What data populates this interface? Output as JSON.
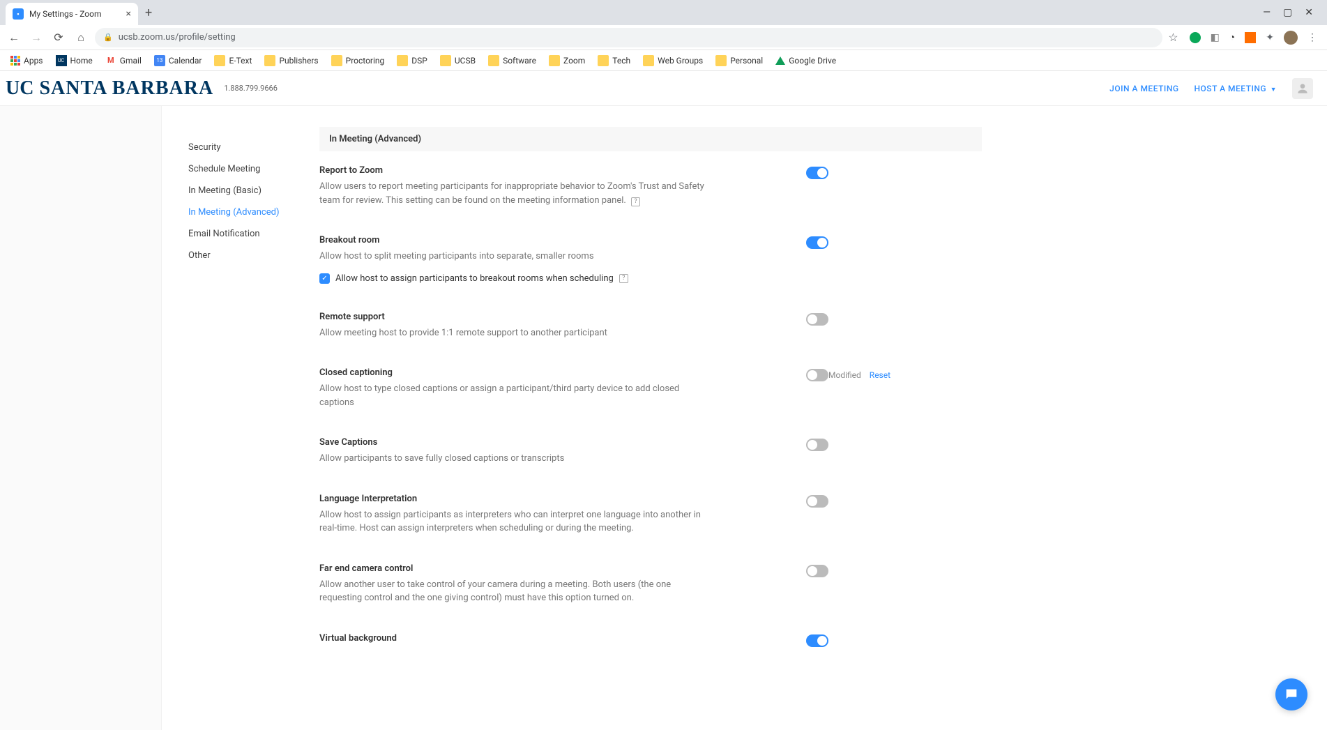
{
  "browser": {
    "tab_title": "My Settings - Zoom",
    "url": "ucsb.zoom.us/profile/setting"
  },
  "bookmarks": {
    "apps": "Apps",
    "home": "Home",
    "gmail": "Gmail",
    "calendar": "Calendar",
    "etext": "E-Text",
    "publishers": "Publishers",
    "proctoring": "Proctoring",
    "dsp": "DSP",
    "ucsb": "UCSB",
    "software": "Software",
    "zoom": "Zoom",
    "tech": "Tech",
    "webgroups": "Web Groups",
    "personal": "Personal",
    "googledrive": "Google Drive"
  },
  "header": {
    "logo_uc": "UC",
    "logo_rest": "SANTA BARBARA",
    "phone": "1.888.799.9666",
    "join": "JOIN A MEETING",
    "host": "HOST A MEETING"
  },
  "sidenav": {
    "security": "Security",
    "schedule": "Schedule Meeting",
    "basic": "In Meeting (Basic)",
    "advanced": "In Meeting (Advanced)",
    "email": "Email Notification",
    "other": "Other"
  },
  "section_title": "In Meeting (Advanced)",
  "settings": {
    "report": {
      "title": "Report to Zoom",
      "desc": "Allow users to report meeting participants for inappropriate behavior to Zoom's Trust and Safety team for review. This setting can be found on the meeting information panel."
    },
    "breakout": {
      "title": "Breakout room",
      "desc": "Allow host to split meeting participants into separate, smaller rooms",
      "sub": "Allow host to assign participants to breakout rooms when scheduling"
    },
    "remote": {
      "title": "Remote support",
      "desc": "Allow meeting host to provide 1:1 remote support to another participant"
    },
    "cc": {
      "title": "Closed captioning",
      "desc": "Allow host to type closed captions or assign a participant/third party device to add closed captions",
      "modified": "Modified",
      "reset": "Reset"
    },
    "savecap": {
      "title": "Save Captions",
      "desc": "Allow participants to save fully closed captions or transcripts"
    },
    "lang": {
      "title": "Language Interpretation",
      "desc": "Allow host to assign participants as interpreters who can interpret one language into another in real-time. Host can assign interpreters when scheduling or during the meeting."
    },
    "farend": {
      "title": "Far end camera control",
      "desc": "Allow another user to take control of your camera during a meeting. Both users (the one requesting control and the one giving control) must have this option turned on."
    },
    "vbg": {
      "title": "Virtual background"
    }
  }
}
